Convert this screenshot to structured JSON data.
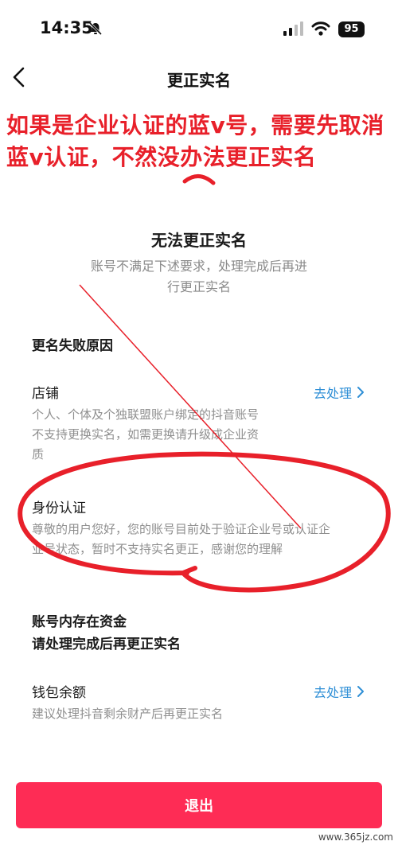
{
  "status_bar": {
    "time": "14:35",
    "battery": "95"
  },
  "nav": {
    "title": "更正实名"
  },
  "annotation": {
    "note_line1": "如果是企业认证的蓝v号，需要先取消",
    "note_line2": "蓝v认证，不然没办法更正实名",
    "color": "#e8202a"
  },
  "dialog": {
    "title": "无法更正实名",
    "desc_line1": "账号不满足下述要求，处理完成后再进",
    "desc_line2": "行更正实名"
  },
  "failure_section": {
    "heading": "更名失败原因",
    "items": [
      {
        "title": "店铺",
        "action": "去处理",
        "desc_line1": "个人、个体及个独联盟账户绑定的抖音账号",
        "desc_line2": "不支持更换实名，如需更换请升级成企业资",
        "desc_line3": "质"
      },
      {
        "title": "身份认证",
        "desc_line1": "尊敬的用户您好，您的账号目前处于验证企业号或认证企",
        "desc_line2": "业号状态，暂时不支持实名更正，感谢您的理解"
      }
    ]
  },
  "funds_section": {
    "heading_line1": "账号内存在资金",
    "heading_line2": "请处理完成后再更正实名",
    "items": [
      {
        "title": "钱包余额",
        "action": "去处理",
        "desc": "建议处理抖音剩余财产后再更正实名"
      }
    ]
  },
  "exit_button": {
    "label": "退出",
    "color": "#fe2c55"
  },
  "link_color": "#2f8fd6",
  "watermark": "www.365jz.com"
}
